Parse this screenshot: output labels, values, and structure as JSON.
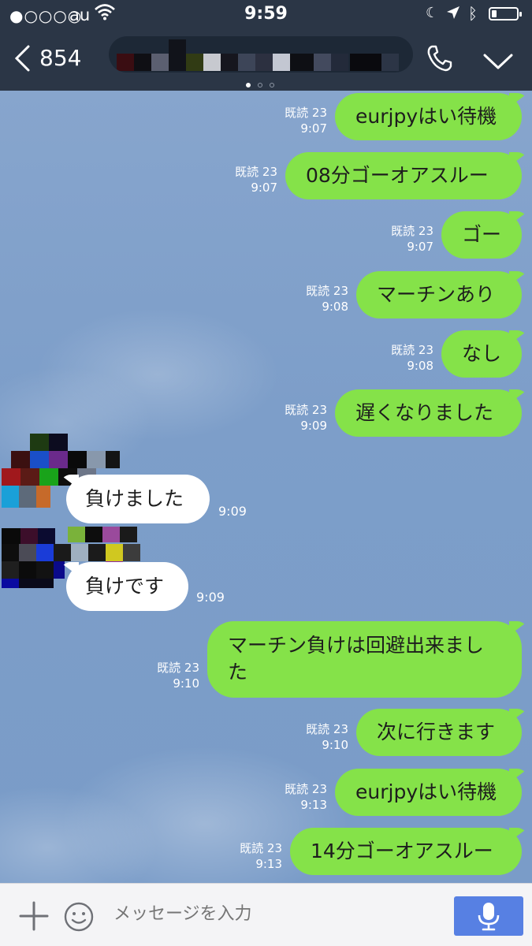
{
  "status_bar": {
    "signal": "●○○○○",
    "carrier": "au",
    "time": "9:59"
  },
  "header": {
    "back_count": "854"
  },
  "messages_out": [
    {
      "text": "eurjpyはい待機",
      "read": "既読 23",
      "time": "9:07"
    },
    {
      "text": "08分ゴーオアスルー",
      "read": "既読 23",
      "time": "9:07"
    },
    {
      "text": "ゴー",
      "read": "既読 23",
      "time": "9:07"
    },
    {
      "text": "マーチンあり",
      "read": "既読 23",
      "time": "9:08"
    },
    {
      "text": "なし",
      "read": "既読 23",
      "time": "9:08"
    },
    {
      "text": "遅くなりました",
      "read": "既読 23",
      "time": "9:09"
    },
    {
      "text_line1": "マーチン負けは回避出来まし",
      "text_line2": "た",
      "read": "既読 23",
      "time": "9:10"
    },
    {
      "text": "次に行きます",
      "read": "既読 23",
      "time": "9:10"
    },
    {
      "text": "eurjpyはい待機",
      "read": "既読 23",
      "time": "9:13"
    },
    {
      "text": "14分ゴーオアスルー",
      "read": "既読 23",
      "time": "9:13"
    }
  ],
  "messages_in": [
    {
      "text": "負けました",
      "time": "9:09"
    },
    {
      "text": "負けです",
      "time": "9:09"
    }
  ],
  "input_bar": {
    "placeholder": "メッセージを入力"
  },
  "colors": {
    "header_bg": "#2b3646",
    "bubble_out": "#85e249",
    "bubble_in": "#ffffff",
    "mic_button": "#5780e3"
  }
}
